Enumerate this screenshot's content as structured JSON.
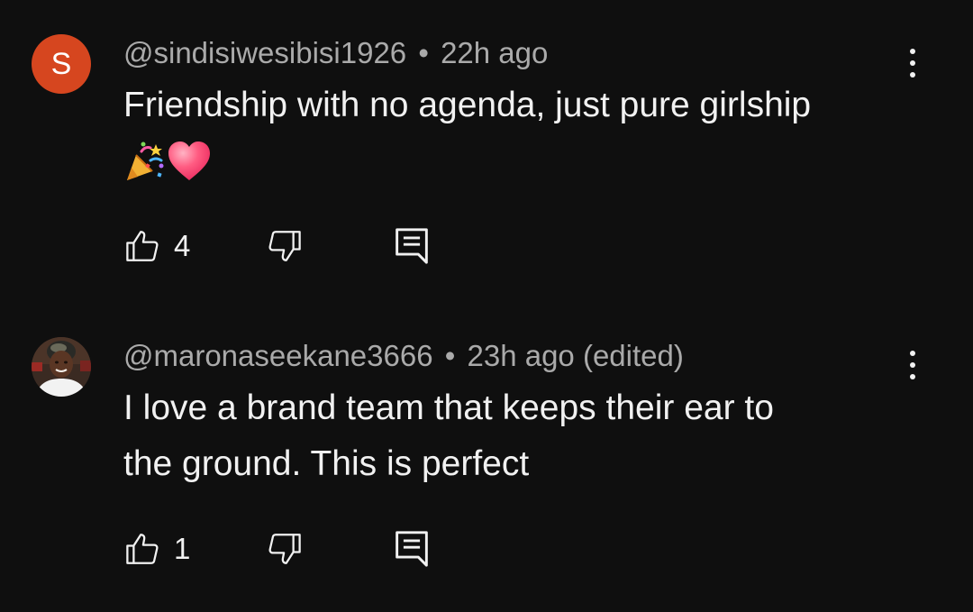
{
  "comments": [
    {
      "avatar_letter": "S",
      "avatar_color": "#d6461f",
      "author": "@sindisiwesibisi1926",
      "separator": "•",
      "time": "22h ago",
      "edited": "",
      "text_lines": [
        "Friendship with no agenda, just pure girlship"
      ],
      "emojis": [
        "party-popper-emoji",
        "heart-emoji"
      ],
      "likes": "4"
    },
    {
      "avatar_letter": "",
      "author": "@maronaseekane3666",
      "separator": "•",
      "time": "23h ago",
      "edited": "(edited)",
      "text_lines": [
        "I love a brand team that keeps their ear to",
        "the ground. This is perfect"
      ],
      "likes": "1"
    }
  ],
  "colors": {
    "background": "#0f0f0f",
    "primary_text": "#f1f1f1",
    "secondary_text": "#aaaaaa"
  }
}
